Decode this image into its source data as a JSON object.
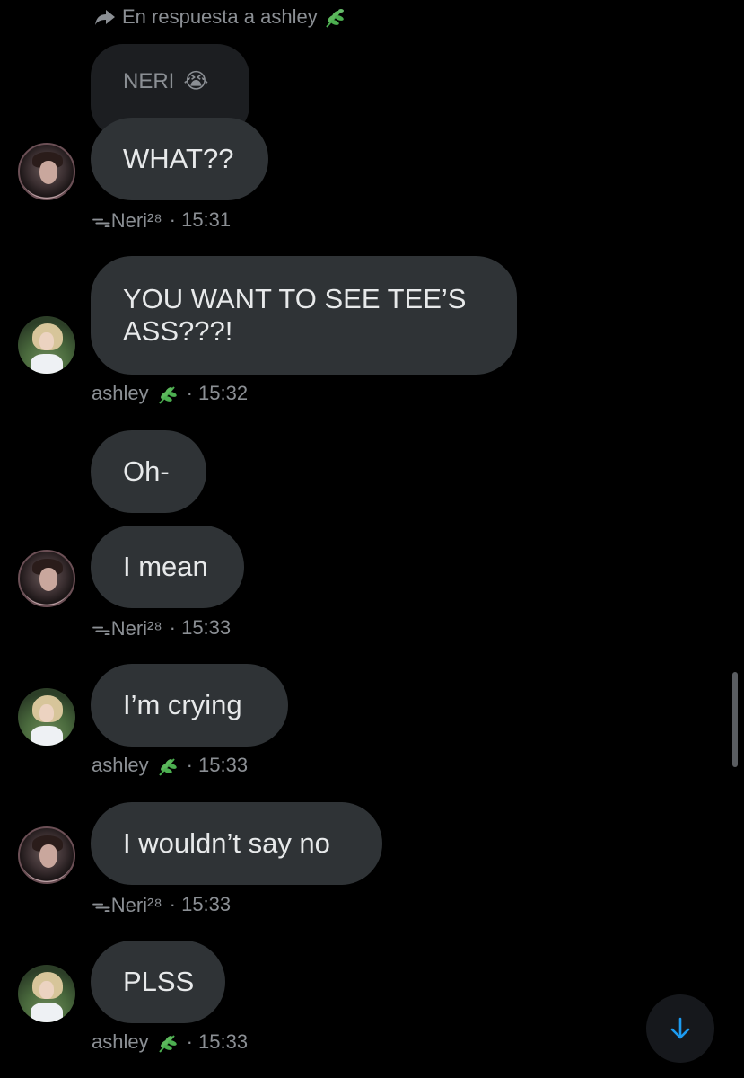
{
  "reply": {
    "label": "En respuesta a ashley"
  },
  "quoted_message": {
    "text": "NERI",
    "emoji": "😭"
  },
  "messages": [
    {
      "text": "WHAT??"
    },
    {
      "text_line1": "YOU WANT TO SEE TEE’S",
      "text_line2": "ASS???!"
    },
    {
      "text": "Oh-"
    },
    {
      "text": "I mean"
    },
    {
      "text": "I’m crying"
    },
    {
      "text": "I wouldn’t say no"
    },
    {
      "text": "PLSS"
    }
  ],
  "meta": [
    {
      "sender": "ᯓNeri²⁸",
      "time": "· 15:31"
    },
    {
      "sender": "ashley",
      "time": "· 15:32"
    },
    {
      "sender": "ᯓNeri²⁸",
      "time": "· 15:33"
    },
    {
      "sender": "ashley",
      "time": "· 15:33"
    },
    {
      "sender": "ᯓNeri²⁸",
      "time": "· 15:33"
    },
    {
      "sender": "ashley",
      "time": "· 15:33"
    }
  ],
  "icons": {
    "reply": "reply-arrow-icon",
    "leaf": "herb-leaf-emoji",
    "scroll_down": "arrow-down-icon"
  },
  "colors": {
    "background": "#000000",
    "bubble": "#2f3336",
    "quoted_bubble": "#1c1e21",
    "text": "#e7e9ea",
    "muted": "#8b8f94",
    "accent": "#1d9bf0"
  }
}
